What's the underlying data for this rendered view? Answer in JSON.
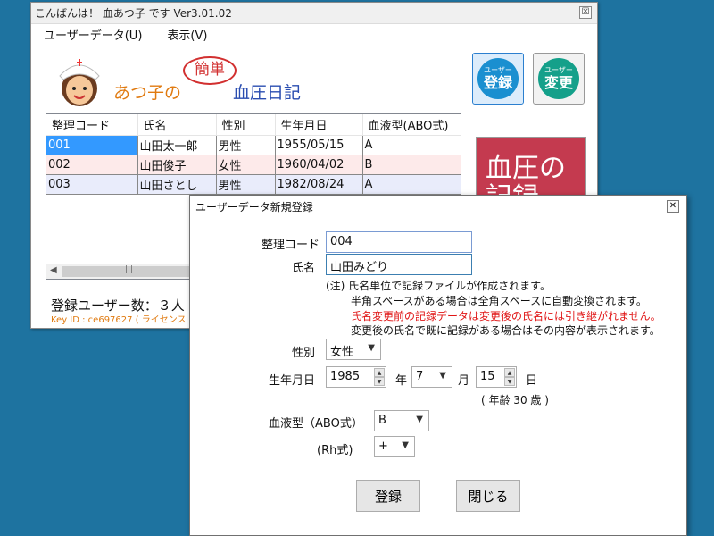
{
  "main": {
    "title": "こんばんは！ 血あつ子 です Ver3.01.02",
    "menu": [
      "ユーザーデータ(U)",
      "表示(V)"
    ],
    "logo": {
      "part1": "あつ子の",
      "bubble": "簡単",
      "part2": "血圧日記"
    },
    "btn_register": {
      "small": "ユーザー",
      "big": "登録"
    },
    "btn_change": {
      "small": "ユーザー",
      "big": "変更"
    },
    "table": {
      "columns": [
        "整理コード",
        "氏名",
        "性別",
        "生年月日",
        "血液型(ABO式)"
      ],
      "rows": [
        [
          "001",
          "山田太一郎",
          "男性",
          "1955/05/15",
          "A"
        ],
        [
          "002",
          "山田俊子",
          "女性",
          "1960/04/02",
          "B"
        ],
        [
          "003",
          "山田さとし",
          "男性",
          "1982/08/24",
          "A"
        ]
      ]
    },
    "count_label": "登録ユーザー数：３人",
    "key_label": "Key ID : ce697627 ( ライセンス",
    "banner": "血圧の記録"
  },
  "dialog": {
    "title": "ユーザーデータ新規登録",
    "code_label": "整理コード",
    "code_value": "004",
    "name_label": "氏名",
    "name_value": "山田みどり",
    "notes": [
      "(注) 氏名単位で記録ファイルが作成されます。",
      "半角スペースがある場合は全角スペースに自動変換されます。",
      "氏名変更前の記録データは変更後の氏名には引き継がれません。",
      "変更後の氏名で既に記録がある場合はその内容が表示されます。"
    ],
    "gender_label": "性別",
    "gender_value": "女性",
    "dob_label": "生年月日",
    "year_value": "1985",
    "year_unit": "年",
    "month_value": "7",
    "month_unit": "月",
    "day_value": "15",
    "day_unit": "日",
    "age_text": "( 年齢 30 歳 )",
    "blood_label": "血液型（ABO式）",
    "blood_value": "B",
    "rh_label": "(Rh式)",
    "rh_value": "+",
    "register_button": "登録",
    "close_button": "閉じる"
  }
}
